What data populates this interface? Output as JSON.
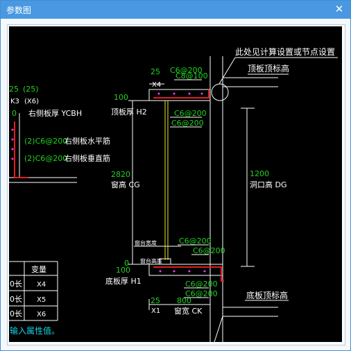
{
  "window": {
    "title": "参数图",
    "close_icon": "close-icon"
  },
  "drawing": {
    "note_top": "此处见计算设置或节点设置",
    "roof_slab_top_elev": "顶板顶标高",
    "left_25": "25",
    "left_25_paren": "(25)",
    "left_k3": "K3",
    "left_x6": "(X6)",
    "left_zero": "0",
    "right_wall_thickness": "右侧板厚 YCBH",
    "rebar_horiz_value": "(2)C6@200",
    "rebar_horiz_label": "右侧板水平筋",
    "rebar_vert_value": "(2)C6@200",
    "rebar_vert_label": "右侧板垂直筋",
    "top_25": "25",
    "top_x4": "X4",
    "top_c8": "C8@100",
    "top_c6": "C6@200",
    "top_100": "100",
    "roof_thickness": "顶板厚 H2",
    "top_c6_b1": "C6@200",
    "top_c6_b2": "C6@200",
    "dim_2820": "2820",
    "window_height": "窗高 CG",
    "dim_1200": "1200",
    "opening_height": "洞口高 DG",
    "bot_c6_1": "C6@200",
    "bot_c6_2": "C6@200",
    "sill_width": "窗台宽度",
    "sill_height": "窗台高度",
    "bot_zero": "0",
    "bot_100": "100",
    "floor_thickness": "底板厚 H1",
    "bot_c6_3": "C6@200",
    "bot_c6_4": "C6@200",
    "floor_slab_top_elev": "底板顶标高",
    "bot_25": "25",
    "bot_x1": "X1",
    "dim_800": "800",
    "window_width": "窗宽 CK"
  },
  "table": {
    "header": "变量",
    "rows": [
      {
        "name": "0长",
        "var": "X4"
      },
      {
        "name": "0长",
        "var": "X5"
      },
      {
        "name": "0长",
        "var": "X6"
      }
    ]
  },
  "hint": "输入属性值。",
  "colors": {
    "title_bar": "#4a98e2",
    "canvas": "#000000",
    "value_green": "#21d321",
    "label_white": "#ffffff",
    "rebar_red": "#e02020",
    "rebar_magenta": "#ff33ff",
    "yellow_line": "#e8e830",
    "hint_cyan": "#17d4e6"
  }
}
